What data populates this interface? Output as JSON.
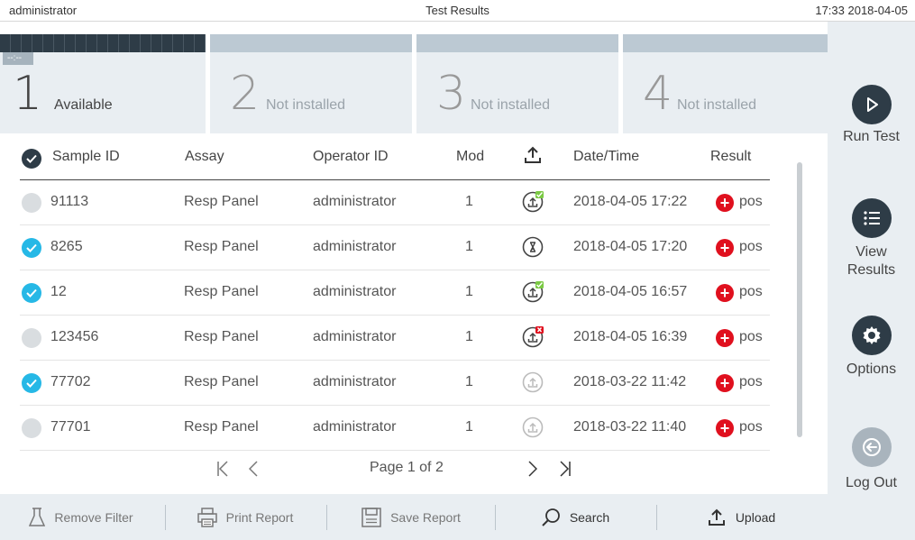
{
  "topbar": {
    "user": "administrator",
    "title": "Test Results",
    "clock": "17:33 2018-04-05"
  },
  "modules": [
    {
      "number": "1",
      "status": "Available",
      "timer": "--:--"
    },
    {
      "number": "2",
      "status": "Not installed"
    },
    {
      "number": "3",
      "status": "Not installed"
    },
    {
      "number": "4",
      "status": "Not installed"
    }
  ],
  "sidebar": {
    "run_test": "Run Test",
    "view_results_1": "View",
    "view_results_2": "Results",
    "options": "Options",
    "log_out": "Log Out"
  },
  "table": {
    "headers": {
      "sample_id": "Sample ID",
      "assay": "Assay",
      "operator_id": "Operator ID",
      "mod": "Mod",
      "datetime": "Date/Time",
      "result": "Result"
    },
    "rows": [
      {
        "selected": false,
        "sample_id": "91113",
        "assay": "Resp Panel",
        "operator": "administrator",
        "mod": "1",
        "upload": "uploaded",
        "datetime": "2018-04-05 17:22",
        "result": "pos"
      },
      {
        "selected": true,
        "sample_id": "8265",
        "assay": "Resp Panel",
        "operator": "administrator",
        "mod": "1",
        "upload": "pending",
        "datetime": "2018-04-05 17:20",
        "result": "pos"
      },
      {
        "selected": true,
        "sample_id": "12",
        "assay": "Resp Panel",
        "operator": "administrator",
        "mod": "1",
        "upload": "uploaded",
        "datetime": "2018-04-05 16:57",
        "result": "pos"
      },
      {
        "selected": false,
        "sample_id": "123456",
        "assay": "Resp Panel",
        "operator": "administrator",
        "mod": "1",
        "upload": "failed",
        "datetime": "2018-04-05 16:39",
        "result": "pos"
      },
      {
        "selected": true,
        "sample_id": "77702",
        "assay": "Resp Panel",
        "operator": "administrator",
        "mod": "1",
        "upload": "not-uploaded",
        "datetime": "2018-03-22 11:42",
        "result": "pos"
      },
      {
        "selected": false,
        "sample_id": "77701",
        "assay": "Resp Panel",
        "operator": "administrator",
        "mod": "1",
        "upload": "not-uploaded",
        "datetime": "2018-03-22 11:40",
        "result": "pos"
      }
    ]
  },
  "pager": {
    "label": "Page 1 of 2"
  },
  "toolbar": {
    "remove_filter": "Remove Filter",
    "print_report": "Print Report",
    "save_report": "Save Report",
    "search": "Search",
    "upload": "Upload"
  },
  "colors": {
    "dark": "#2e3c47",
    "accent": "#26b8e6",
    "positive": "#e0101e",
    "panel": "#e9eef2"
  }
}
